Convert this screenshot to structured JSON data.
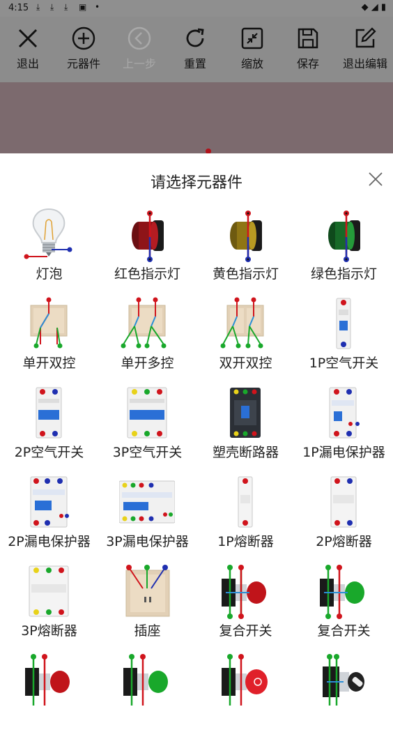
{
  "status_bar": {
    "time": "4:15",
    "notification_icons": [
      "download-icon",
      "download-icon",
      "download-icon",
      "app-icon",
      "dot-icon"
    ]
  },
  "toolbar": {
    "exit": "退出",
    "components": "元器件",
    "undo": "上一步",
    "reset": "重置",
    "zoom": "缩放",
    "save": "保存",
    "exit_edit": "退出编辑"
  },
  "sheet": {
    "title": "请选择元器件",
    "items": [
      {
        "label": "灯泡"
      },
      {
        "label": "红色指示灯"
      },
      {
        "label": "黄色指示灯"
      },
      {
        "label": "绿色指示灯"
      },
      {
        "label": "单开双控"
      },
      {
        "label": "单开多控"
      },
      {
        "label": "双开双控"
      },
      {
        "label": "1P空气开关"
      },
      {
        "label": "2P空气开关"
      },
      {
        "label": "3P空气开关"
      },
      {
        "label": "塑壳断路器"
      },
      {
        "label": "1P漏电保护器"
      },
      {
        "label": "2P漏电保护器"
      },
      {
        "label": "3P漏电保护器"
      },
      {
        "label": "1P熔断器"
      },
      {
        "label": "2P熔断器"
      },
      {
        "label": "3P熔断器"
      },
      {
        "label": "插座"
      },
      {
        "label": "复合开关"
      },
      {
        "label": "复合开关"
      },
      {
        "label": ""
      },
      {
        "label": ""
      },
      {
        "label": ""
      },
      {
        "label": ""
      }
    ]
  },
  "colors": {
    "toolbar_bg": "#8c8c8c",
    "canvas_bg": "#7c6a6e",
    "wire_red": "#d0141c",
    "wire_blue": "#1f2fb0",
    "wire_green": "#19a82b"
  }
}
